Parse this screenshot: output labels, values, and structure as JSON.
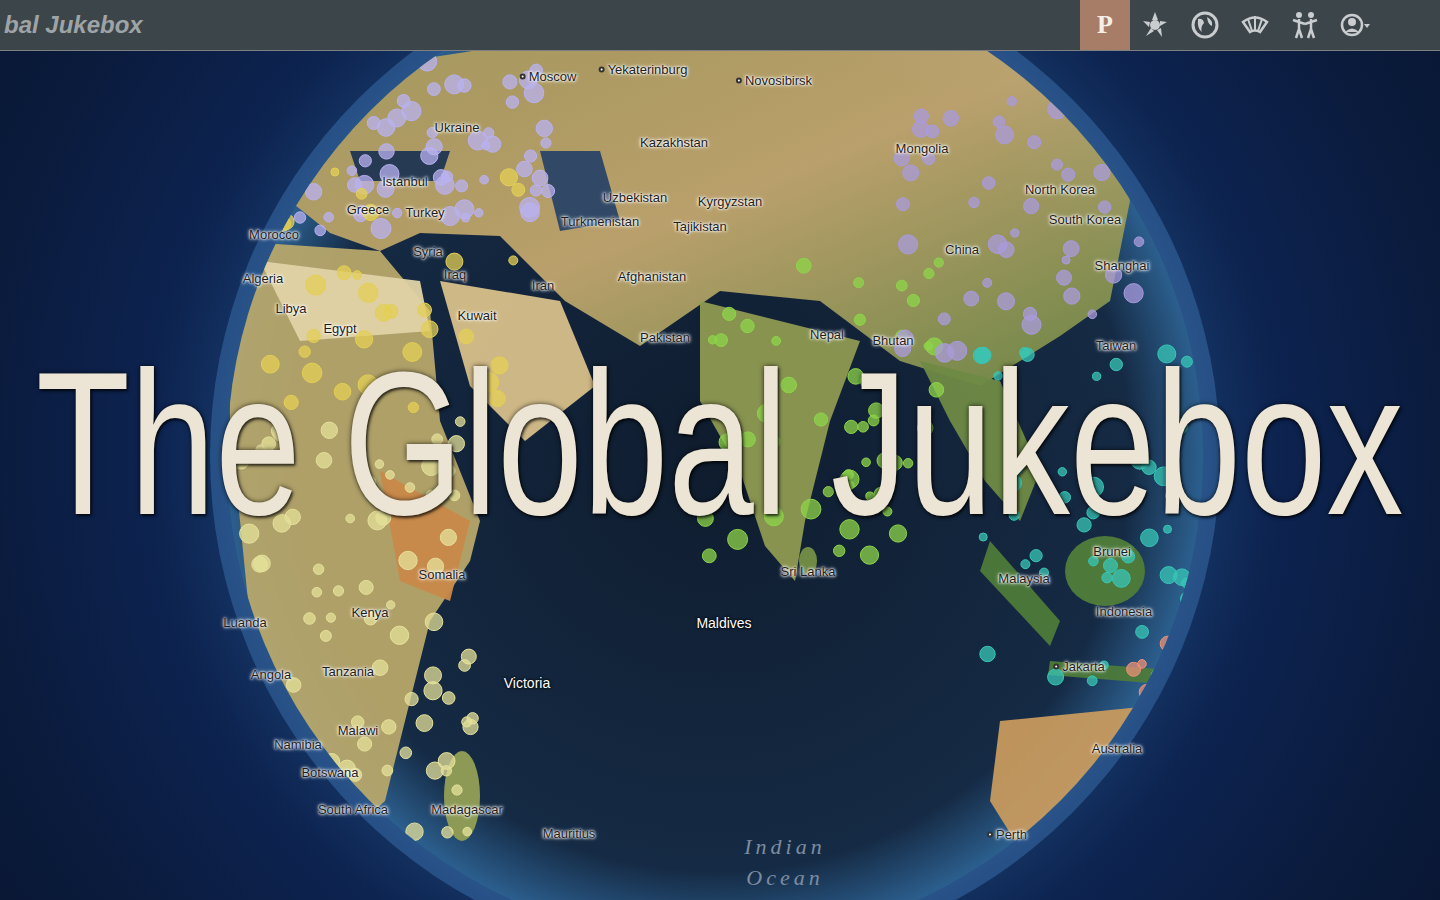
{
  "nav": {
    "logo": "bal Jukebox",
    "buttons": [
      {
        "label": "P",
        "selected": true
      }
    ]
  },
  "title": "The Global Jukebox",
  "dot_groups": [
    {
      "color": "#b9b2f0"
    },
    {
      "color": "#e3cf55"
    },
    {
      "color": "#e4e09a"
    },
    {
      "color": "#8ed44a"
    },
    {
      "color": "#a99bdc"
    },
    {
      "color": "#38c6b6"
    },
    {
      "color": "#ea9078"
    }
  ],
  "map_labels": [
    {
      "text": "Yekaterinburg",
      "kind": "city"
    },
    {
      "text": "Moscow",
      "kind": "city"
    },
    {
      "text": "Novosibirsk",
      "kind": "city"
    },
    {
      "text": "Ukraine",
      "kind": "country"
    },
    {
      "text": "Kazakhstan",
      "kind": "country"
    },
    {
      "text": "Mongolia",
      "kind": "country"
    },
    {
      "text": "Uzbekistan",
      "kind": "country"
    },
    {
      "text": "Kyrgyzstan",
      "kind": "country"
    },
    {
      "text": "Turkmenistan",
      "kind": "country"
    },
    {
      "text": "Tajikistan",
      "kind": "country"
    },
    {
      "text": "North Korea",
      "kind": "country"
    },
    {
      "text": "South Korea",
      "kind": "country"
    },
    {
      "text": "China",
      "kind": "country"
    },
    {
      "text": "Shanghai",
      "kind": "country"
    },
    {
      "text": "Afghanistan",
      "kind": "country"
    },
    {
      "text": "Iran",
      "kind": "country"
    },
    {
      "text": "Iraq",
      "kind": "country"
    },
    {
      "text": "Syria",
      "kind": "country"
    },
    {
      "text": "Turkey",
      "kind": "country"
    },
    {
      "text": "Greece",
      "kind": "country"
    },
    {
      "text": "Istanbul",
      "kind": "country"
    },
    {
      "text": "Kuwait",
      "kind": "country"
    },
    {
      "text": "Pakistan",
      "kind": "country"
    },
    {
      "text": "Nepal",
      "kind": "country"
    },
    {
      "text": "Bhutan",
      "kind": "country"
    },
    {
      "text": "Taiwan",
      "kind": "country"
    },
    {
      "text": "Libya",
      "kind": "country"
    },
    {
      "text": "Algeria",
      "kind": "country"
    },
    {
      "text": "Morocco",
      "kind": "country"
    },
    {
      "text": "Egypt",
      "kind": "country"
    },
    {
      "text": "Somalia",
      "kind": "country"
    },
    {
      "text": "Kenya",
      "kind": "country"
    },
    {
      "text": "Tanzania",
      "kind": "country"
    },
    {
      "text": "Luanda",
      "kind": "country"
    },
    {
      "text": "Angola",
      "kind": "country"
    },
    {
      "text": "Malawi",
      "kind": "country"
    },
    {
      "text": "Namibia",
      "kind": "country"
    },
    {
      "text": "Botswana",
      "kind": "country"
    },
    {
      "text": "South Africa",
      "kind": "country"
    },
    {
      "text": "Madagascar",
      "kind": "country"
    },
    {
      "text": "Mauritius",
      "kind": "country"
    },
    {
      "text": "Maldives",
      "kind": "sea"
    },
    {
      "text": "Victoria",
      "kind": "seacity"
    },
    {
      "text": "Sri Lanka",
      "kind": "country"
    },
    {
      "text": "Malaysia",
      "kind": "country"
    },
    {
      "text": "Brunei",
      "kind": "country"
    },
    {
      "text": "Indonesia",
      "kind": "country"
    },
    {
      "text": "Jakarta",
      "kind": "city"
    },
    {
      "text": "Australia",
      "kind": "country"
    },
    {
      "text": "Perth",
      "kind": "city"
    },
    {
      "text": "Indian",
      "kind": "ocean"
    },
    {
      "text": "Ocean",
      "kind": "ocean"
    }
  ]
}
